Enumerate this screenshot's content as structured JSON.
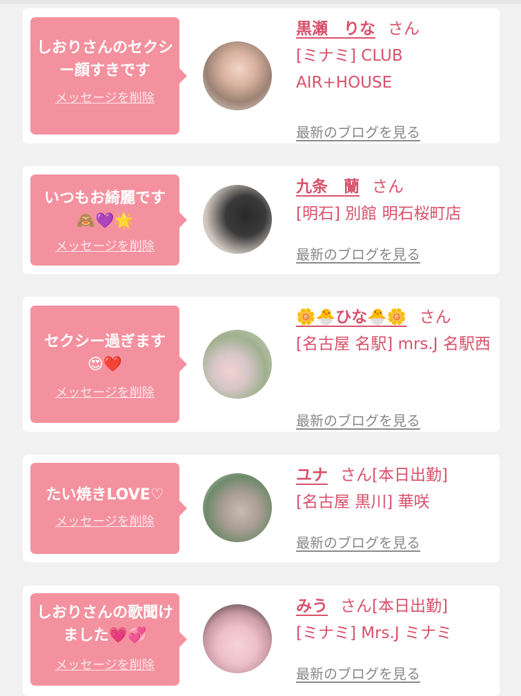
{
  "messages": [
    {
      "text": "しおりさんのセクシー顔すきです",
      "delete_label": "メッセージを削除",
      "name": "黒瀬　りな",
      "suffix": "さん",
      "shop": "[ミナミ] CLUB AIR+HOUSE",
      "blog_label": "最新のブログを見る"
    },
    {
      "text": "いつもお綺麗です🙈💜🌟",
      "delete_label": "メッセージを削除",
      "name": "九条　蘭",
      "suffix": "さん",
      "shop": "[明石] 別館 明石桜町店",
      "blog_label": "最新のブログを見る"
    },
    {
      "text": "セクシー過ぎます😍❤️",
      "delete_label": "メッセージを削除",
      "name": "🌼🐣ひな🐣🌼",
      "suffix": "さん",
      "shop": "[名古屋 名駅] mrs.J 名駅西",
      "blog_label": "最新のブログを見る"
    },
    {
      "text": "たい焼きLOVE♡",
      "delete_label": "メッセージを削除",
      "name": "ユナ",
      "suffix": "さん[本日出勤]",
      "shop": "[名古屋 黒川] 華咲",
      "blog_label": "最新のブログを見る"
    },
    {
      "text": "しおりさんの歌聞けました💗💞",
      "delete_label": "メッセージを削除",
      "name": "みう",
      "suffix": "さん[本日出勤]",
      "shop": "[ミナミ] Mrs.J ミナミ",
      "blog_label": "最新のブログを見る"
    }
  ],
  "colors": {
    "accent": "#d9506a",
    "bubble": "#f4919f",
    "background": "#f1f1f1",
    "muted_link": "#888888"
  }
}
